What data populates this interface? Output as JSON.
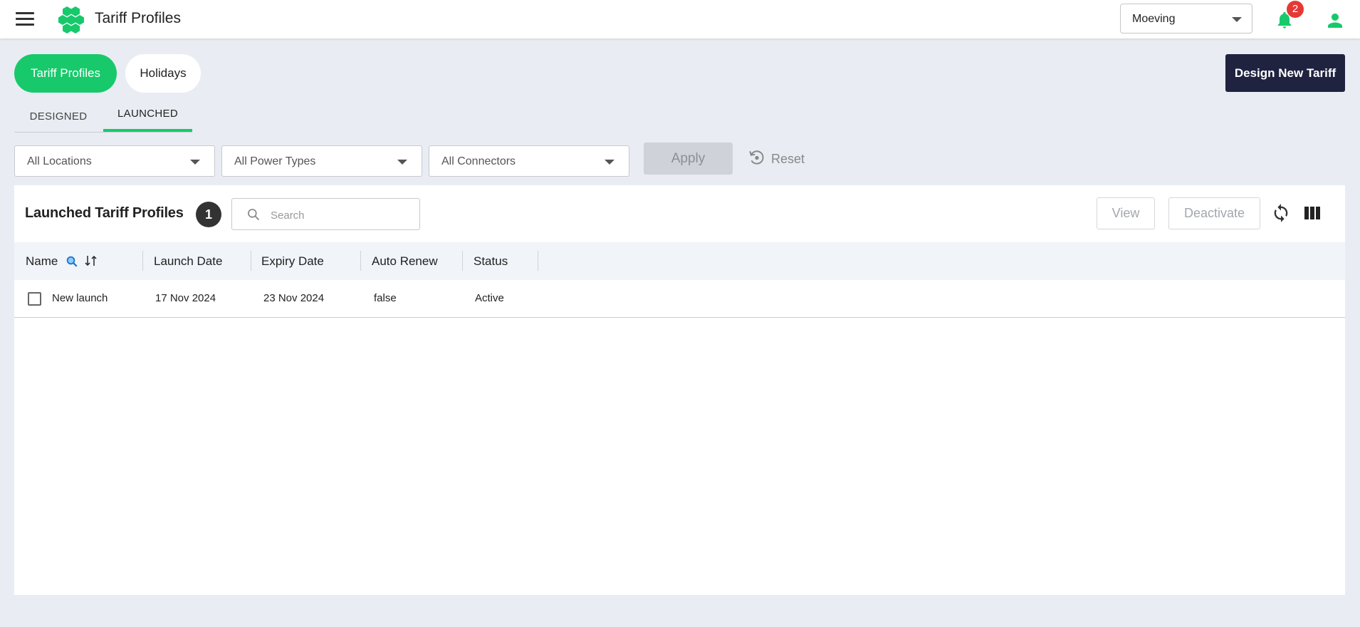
{
  "header": {
    "app_title": "Tariff Profiles",
    "menu_icon": "menu-icon",
    "logo_icon": "hexagon-cluster-logo",
    "account_select": {
      "value": "Moeving"
    },
    "notifications": {
      "icon": "bell-icon",
      "count": "2"
    },
    "user_icon": "user-icon"
  },
  "top_tabs": [
    {
      "label": "Tariff Profiles",
      "active": true
    },
    {
      "label": "Holidays",
      "active": false
    }
  ],
  "primary_action": {
    "label": "Design New Tariff"
  },
  "sub_tabs": [
    {
      "label": "DESIGNED",
      "active": false
    },
    {
      "label": "LAUNCHED",
      "active": true
    }
  ],
  "filters": {
    "locations": "All Locations",
    "power_types": "All Power Types",
    "connectors": "All Connectors",
    "apply_label": "Apply",
    "reset_label": "Reset"
  },
  "table_card": {
    "title": "Launched Tariff Profiles",
    "count": "1",
    "search_placeholder": "Search",
    "view_label": "View",
    "deactivate_label": "Deactivate",
    "columns": [
      "Name",
      "Launch Date",
      "Expiry Date",
      "Auto Renew",
      "Status"
    ],
    "rows": [
      {
        "name": "New launch",
        "launch_date": "17 Nov 2024",
        "expiry_date": "23 Nov 2024",
        "auto_renew": "false",
        "status": "Active"
      }
    ]
  },
  "colors": {
    "accent": "#17c96b",
    "dark_button": "#1f2340",
    "badge_red": "#e53935",
    "page_bg": "#e9edf3"
  }
}
